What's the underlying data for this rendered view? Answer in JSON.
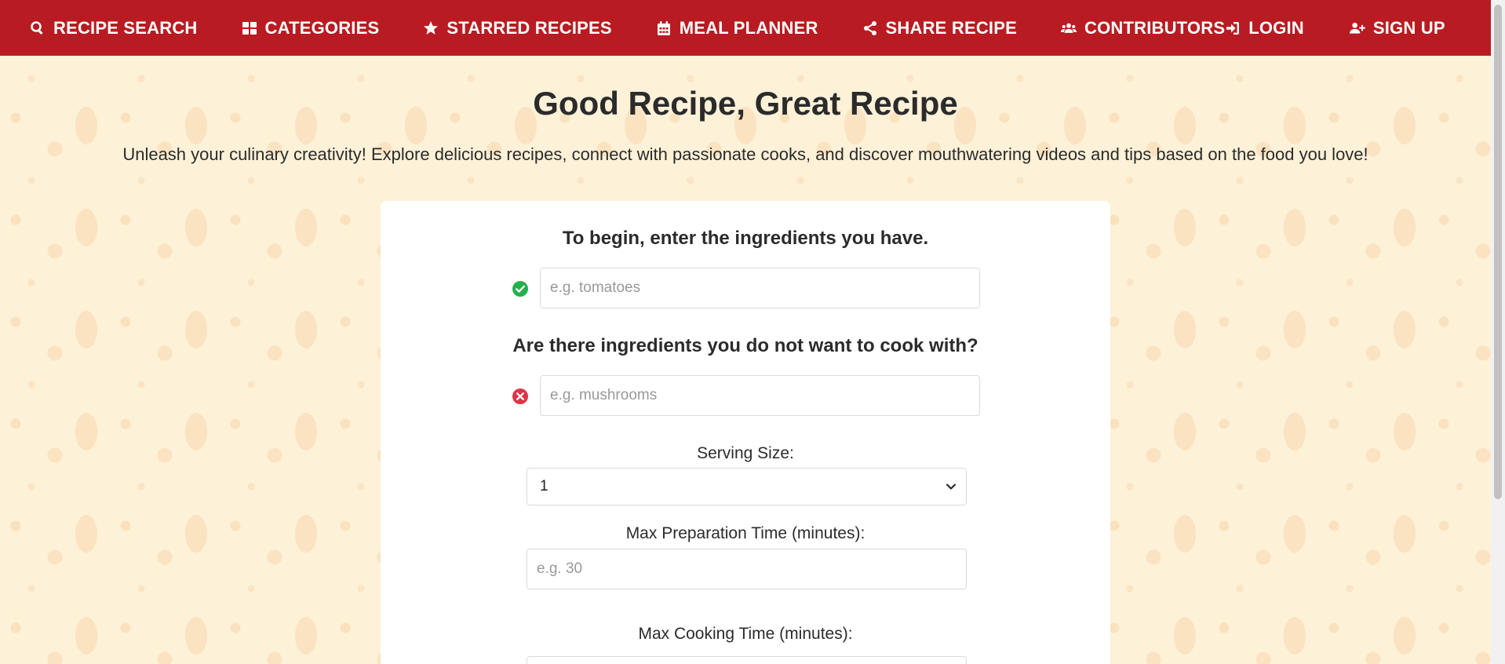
{
  "nav": {
    "items": [
      {
        "label": "RECIPE SEARCH",
        "icon": "search-icon"
      },
      {
        "label": "CATEGORIES",
        "icon": "grid-icon"
      },
      {
        "label": "STARRED RECIPES",
        "icon": "star-icon"
      },
      {
        "label": "MEAL PLANNER",
        "icon": "calendar-icon"
      },
      {
        "label": "SHARE RECIPE",
        "icon": "share-icon"
      },
      {
        "label": "CONTRIBUTORS",
        "icon": "users-icon"
      }
    ],
    "login": {
      "label": "LOGIN",
      "icon": "login-icon"
    },
    "signup": {
      "label": "SIGN UP",
      "icon": "user-plus-icon"
    }
  },
  "hero": {
    "title": "Good Recipe, Great Recipe",
    "subtitle": "Unleash your culinary creativity! Explore delicious recipes, connect with passionate cooks, and discover mouthwatering videos and tips based on the food you love!"
  },
  "form": {
    "include": {
      "heading": "To begin, enter the ingredients you have.",
      "placeholder": "e.g. tomatoes",
      "value": "",
      "icon": "check-circle-icon"
    },
    "exclude": {
      "heading": "Are there ingredients you do not want to cook with?",
      "placeholder": "e.g. mushrooms",
      "value": "",
      "icon": "x-circle-icon"
    },
    "serving": {
      "label": "Serving Size:",
      "selected": "1"
    },
    "prep_time": {
      "label": "Max Preparation Time (minutes):",
      "placeholder": "e.g. 30",
      "value": ""
    },
    "cook_time": {
      "label": "Max Cooking Time (minutes):"
    }
  },
  "colors": {
    "brand": "#b81c22",
    "background": "#fdf1d8",
    "success": "#22b14c",
    "danger": "#dc3545"
  }
}
